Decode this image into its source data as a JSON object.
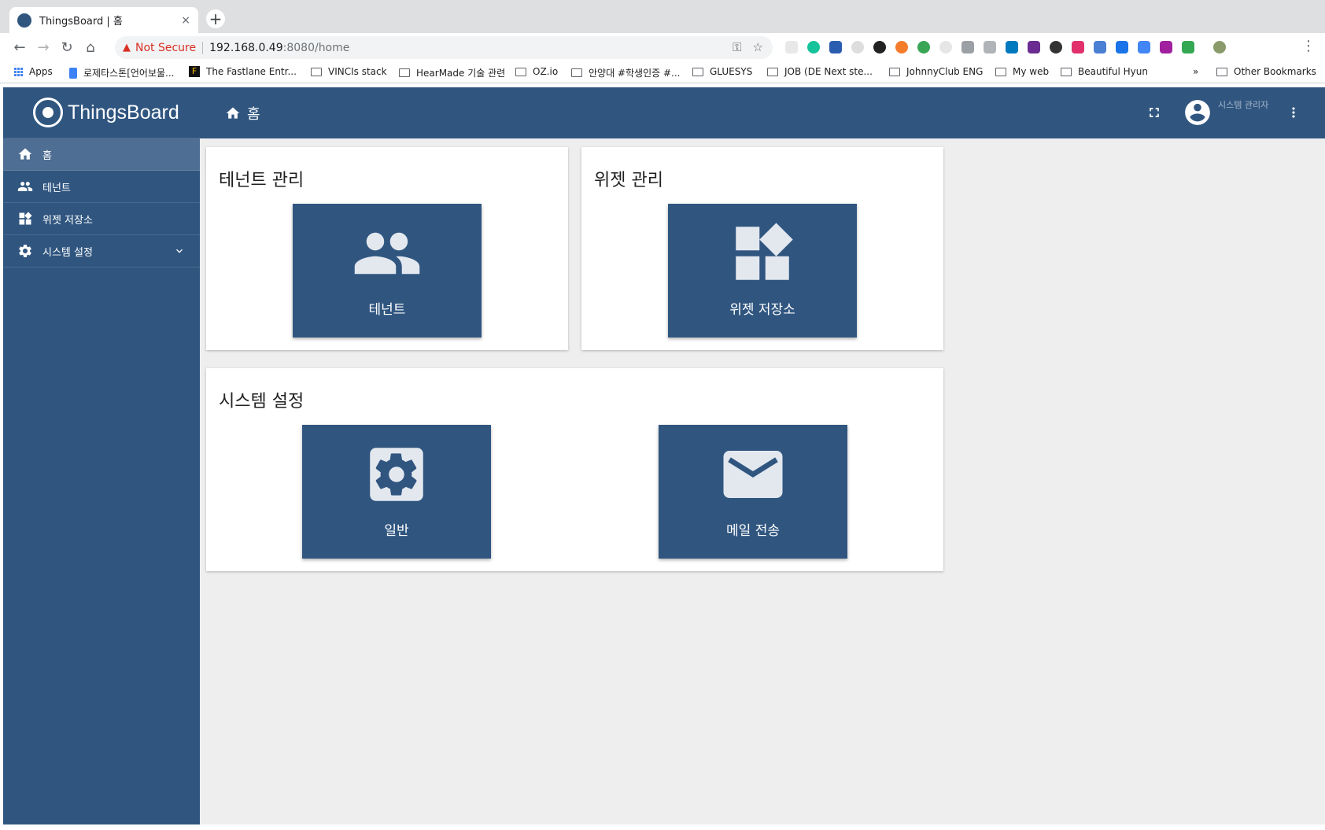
{
  "browser": {
    "tab_title": "ThingsBoard | 홈",
    "tab_close": "×",
    "new_tab": "+",
    "security_warning": "Not Secure",
    "url_host": "192.168.0.49",
    "url_path": ":8080/home",
    "bookmarks": [
      "Apps",
      "로제타스톤[언어보물...",
      "The Fastlane Entr...",
      "VINCIs stack",
      "HearMade 기술 관련",
      "OZ.io",
      "안양대 #학생인증 #...",
      "GLUESYS",
      "JOB (DE Next ste...",
      "JohnnyClub ENG",
      "My web",
      "Beautiful Hyun"
    ],
    "bookmarks_overflow": "»",
    "other_bookmarks": "Other Bookmarks"
  },
  "app": {
    "logo_text": "ThingsBoard",
    "breadcrumb": "홈",
    "user_role": "시스템 관리자",
    "sidebar": [
      {
        "label": "홈",
        "icon": "home-icon"
      },
      {
        "label": "테넌트",
        "icon": "people-icon"
      },
      {
        "label": "위젯 저장소",
        "icon": "widgets-icon"
      },
      {
        "label": "시스템 설정",
        "icon": "gear-icon"
      }
    ],
    "cards": {
      "tenant_mgmt": {
        "title": "테넌트 관리",
        "tile_label": "테넌트"
      },
      "widget_mgmt": {
        "title": "위젯 관리",
        "tile_label": "위젯 저장소"
      },
      "system_settings": {
        "title": "시스템 설정",
        "tile_general": "일반",
        "tile_mail": "메일 전송"
      }
    },
    "colors": {
      "primary": "#305680",
      "background": "#eeeeee",
      "tile_icon": "#e3e8ef"
    }
  }
}
